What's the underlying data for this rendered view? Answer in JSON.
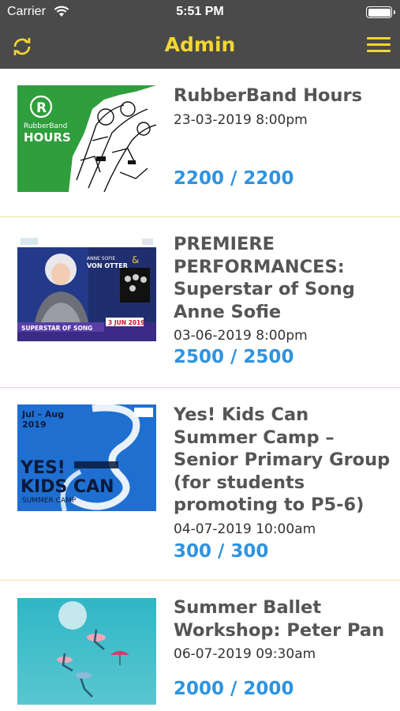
{
  "status_bar": {
    "carrier": "Carrier",
    "time": "5:51 PM"
  },
  "nav": {
    "title": "Admin",
    "left_icon": "refresh-icon",
    "right_icon": "menu-icon"
  },
  "colors": {
    "bar": "#4a4a4a",
    "accent": "#f5d630",
    "count": "#2f93e0",
    "title": "#555555",
    "divider": "#f4df9a"
  },
  "events": [
    {
      "title": "RubberBand Hours",
      "datetime": "23-03-2019 8:00pm",
      "count": "2200 / 2200"
    },
    {
      "title": "PREMIERE PERFORMANCES: Superstar of Song Anne Sofie",
      "datetime": "03-06-2019 8:00pm",
      "count": "2500 / 2500"
    },
    {
      "title": "Yes! Kids Can Summer Camp – Senior Primary Group (for students promoting to P5-6)",
      "datetime": "04-07-2019 10:00am",
      "count": "300 / 300"
    },
    {
      "title": "Summer Ballet Workshop: Peter Pan",
      "datetime": "06-07-2019 09:30am",
      "count": "2000 / 2000"
    }
  ],
  "posters": {
    "rubberband": {
      "brand": "RubberBand",
      "line2": "HOURS"
    },
    "premiere": {
      "name1": "ANNE SOFIE",
      "name2": "VON OTTER",
      "banner": "SUPERSTAR OF SONG",
      "date": "3 JUN 2019"
    },
    "kids": {
      "dates1": "Jul – Aug",
      "dates2": "2019",
      "big1": "YES!",
      "big2": "KIDS CAN",
      "small": "SUMMER CAMP"
    }
  }
}
